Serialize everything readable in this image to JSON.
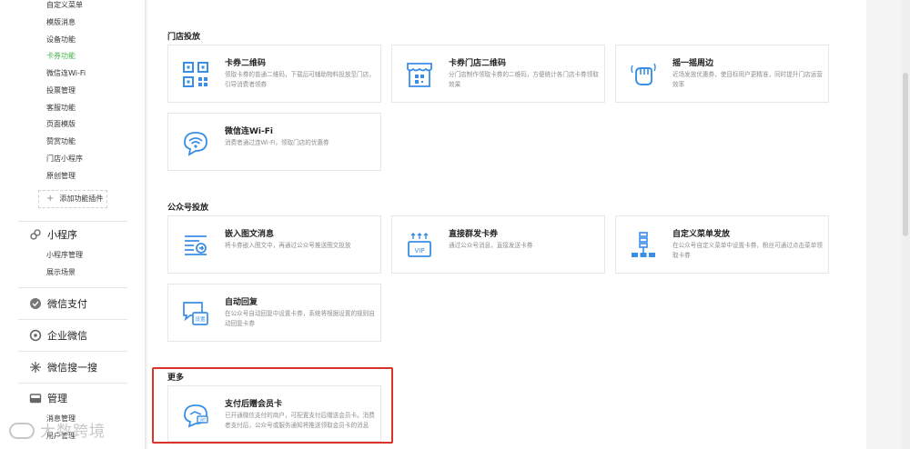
{
  "sidebar": {
    "sub_items": [
      "自定义菜单",
      "模版消息",
      "设备功能",
      "卡券功能",
      "微信连Wi-Fi",
      "投票管理",
      "客服功能",
      "页面模版",
      "赞赏功能",
      "门店小程序",
      "原创管理"
    ],
    "active_item": "卡券功能",
    "add_plugin": "添加功能插件",
    "groups": [
      {
        "label": "小程序",
        "icon": "link-icon",
        "items": [
          "小程序管理",
          "展示场景"
        ]
      },
      {
        "label": "微信支付",
        "icon": "pay-icon",
        "items": []
      },
      {
        "label": "企业微信",
        "icon": "enterprise-icon",
        "items": []
      },
      {
        "label": "微信搜一搜",
        "icon": "sparkle-icon",
        "items": []
      },
      {
        "label": "管理",
        "icon": "folder-icon",
        "items": [
          "消息管理",
          "用户管理"
        ]
      }
    ]
  },
  "sections": {
    "store": {
      "title": "门店投放",
      "cards": [
        {
          "title": "卡券二维码",
          "desc": "领取卡券的普通二维码，下载后可辅助物料投放至门店，引导消费者领券",
          "icon": "qrcode-icon"
        },
        {
          "title": "卡券门店二维码",
          "desc": "分门店制作领取卡券的二维码，方便统计各门店卡券领取效果",
          "icon": "store-qrcode-icon"
        },
        {
          "title": "摇一摇周边",
          "desc": "近场发放优惠券，使目标用户更精准，同时提升门店运营效率",
          "icon": "shake-hand-icon"
        },
        {
          "title": "微信连Wi-Fi",
          "desc": "消费者通过连Wi-Fi，领取门店的优惠券",
          "icon": "wifi-icon"
        }
      ]
    },
    "official": {
      "title": "公众号投放",
      "cards": [
        {
          "title": "嵌入图文消息",
          "desc": "将卡券嵌入图文中，再通过公众号推送图文投放",
          "icon": "article-icon"
        },
        {
          "title": "直接群发卡券",
          "desc": "通过公众号消息，直接发送卡券",
          "icon": "vip-icon"
        },
        {
          "title": "自定义菜单发放",
          "desc": "在公众号自定义菜单中设置卡券，粉丝可通过点击菜单领取卡券",
          "icon": "menu-icon"
        },
        {
          "title": "自动回复",
          "desc": "在公众号自动回复中设置卡券，系统将根据设置的规则自动回复卡券",
          "icon": "auto-reply-icon"
        }
      ]
    },
    "more": {
      "title": "更多",
      "cards": [
        {
          "title": "支付后赠会员卡",
          "desc": "已开通微信支付的商户，可配置支付后赠送会员卡。消费者支付后，公众号或服务通知将推送领取会员卡的消息",
          "icon": "pay-card-icon"
        }
      ]
    }
  },
  "watermark": "大数跨境",
  "colors": {
    "accent": "#44b549",
    "icon_blue": "#3a8ee6",
    "highlight": "#d9342b"
  }
}
